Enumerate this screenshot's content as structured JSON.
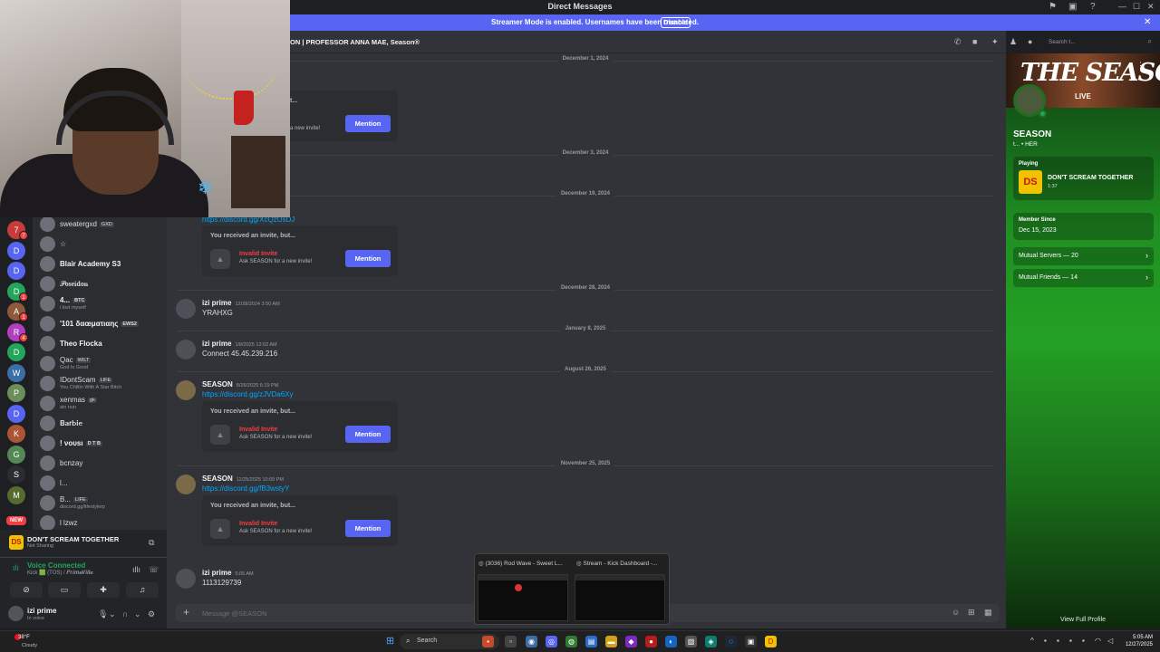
{
  "window": {
    "title": "Direct Messages"
  },
  "banner": {
    "text": "Streamer Mode is enabled. Usernames have been truncated.",
    "button": "Disable"
  },
  "chat_header": {
    "title": "ON | PROFESSOR ANNA MAE, Season®"
  },
  "search": {
    "placeholder": "Search t..."
  },
  "dm_list": [
    {
      "name": "sweatergxd",
      "tag": "GXD",
      "sub": "",
      "bold": false
    },
    {
      "name": "☆",
      "tag": "",
      "sub": "",
      "bold": false
    },
    {
      "name": "Blair Academy S3",
      "tag": "",
      "sub": "",
      "bold": true
    },
    {
      "name": "𝓟𝐨𝐬𝐞𝐢𝐝𝐨𝐧",
      "tag": "",
      "sub": "",
      "bold": false
    },
    {
      "name": "4...",
      "tag": "BTC",
      "sub": "i lost myself",
      "bold": true
    },
    {
      "name": "'101 δαœματιαης",
      "tag": "EWS2",
      "sub": "",
      "bold": true
    },
    {
      "name": "Theo Flocka",
      "tag": "",
      "sub": "",
      "bold": true
    },
    {
      "name": "Qac",
      "tag": "WILT",
      "sub": "God Is Good",
      "bold": false
    },
    {
      "name": "IDontScam",
      "tag": "LIFE",
      "sub": "You Chillin With A Star Bitch",
      "bold": false
    },
    {
      "name": "xenmas",
      "tag": "gk",
      "sub": "ain nun",
      "bold": false
    },
    {
      "name": "𝐁𝐚𝐫𝐛𝐢𝐞",
      "tag": "",
      "sub": "",
      "bold": false
    },
    {
      "name": "! νουѕι",
      "tag": "D T B",
      "sub": "",
      "bold": true
    },
    {
      "name": "bcnzay",
      "tag": "",
      "sub": "",
      "bold": false
    },
    {
      "name": "l...",
      "tag": "",
      "sub": "",
      "bold": false
    },
    {
      "name": "B...",
      "tag": "LIFE",
      "sub": "discord.gg/lifestylerp",
      "bold": false
    },
    {
      "name": "l lzwz",
      "tag": "",
      "sub": "",
      "bold": false
    }
  ],
  "servers": [
    {
      "label": "7",
      "color": "#c93b3b",
      "badge": "7"
    },
    {
      "label": "D",
      "color": "#5865f2",
      "badge": ""
    },
    {
      "label": "D",
      "color": "#5865f2",
      "badge": ""
    },
    {
      "label": "D",
      "color": "#23a55a",
      "badge": "1"
    },
    {
      "label": "A",
      "color": "#8e5a3a",
      "badge": "1"
    },
    {
      "label": "R",
      "color": "#b040c0",
      "badge": "4"
    },
    {
      "label": "D",
      "color": "#23a55a",
      "badge": ""
    },
    {
      "label": "W",
      "color": "#3a6ea5",
      "badge": ""
    },
    {
      "label": "P",
      "color": "#6b8e5a",
      "badge": ""
    },
    {
      "label": "D",
      "color": "#5865f2",
      "badge": ""
    },
    {
      "label": "K",
      "color": "#aa5533",
      "badge": ""
    },
    {
      "label": "G",
      "color": "#558855",
      "badge": ""
    },
    {
      "label": "S",
      "color": "#2b2d31",
      "badge": ""
    },
    {
      "label": "M",
      "color": "#556b2f",
      "badge": ""
    }
  ],
  "servers_new": "NEW",
  "activity": {
    "icon_text": "DS",
    "game": "DON'T SCREAM TOGETHER",
    "status": "Not Sharing"
  },
  "voice": {
    "title": "Voice Connected",
    "server": "Kick 🟩 (TOS) / 𝑷𝒓𝒊𝒎𝒂𝑽𝒊𝒍𝒍𝒆"
  },
  "user": {
    "name": "izi prime",
    "status": "In voice"
  },
  "dates": [
    {
      "text": "December 1, 2024"
    },
    {
      "text": "December 3, 2024"
    },
    {
      "text": "December 19, 2024"
    },
    {
      "text": "December 28, 2024"
    },
    {
      "text": "January 8, 2025"
    },
    {
      "text": "August 26, 2025"
    },
    {
      "text": "November 25, 2025"
    }
  ],
  "messages": [
    {
      "author": "",
      "time": "",
      "text": "",
      "link": "https://discord.gg/XcQzUsDJ"
    },
    {
      "author": "izi prime",
      "time": "12/28/2024 3:50 AM",
      "text": "YRAHXG",
      "link": ""
    },
    {
      "author": "izi prime",
      "time": "1/8/2025 12:02 AM",
      "text": "Connect 45.45.239.216",
      "link": ""
    },
    {
      "author": "SEASON",
      "time": "8/26/2025 6:19 PM",
      "text": "",
      "link": "https://discord.gg/zJVDa6Xy"
    },
    {
      "author": "SEASON",
      "time": "11/25/2025 10:09 PM",
      "text": "",
      "link": "https://discord.gg/fB3wstyY"
    },
    {
      "author": "izi prime",
      "time": "5:05 AM",
      "text": "1113129739",
      "link": ""
    }
  ],
  "invite": {
    "header": "You received an invite, but...",
    "title": "Invalid Invite",
    "sub": "Ask SEASON for a new invite!",
    "button": "Mention"
  },
  "invite_top_partial": {
    "header": "t...",
    "sub": "a new invite!"
  },
  "composer": {
    "placeholder": "Message @SEASON"
  },
  "profile": {
    "banner_text": "THE SEASON",
    "live": "LIVE",
    "name": "SEASON",
    "pronouns": "t... • HER",
    "playing_label": "Playing",
    "game_icon": "DS",
    "game": "DON'T SCREAM TOGETHER",
    "game_time": "1:37",
    "member_since_label": "Member Since",
    "member_since": "Dec 15, 2023",
    "mutual_servers": "Mutual Servers — 20",
    "mutual_friends": "Mutual Friends — 14",
    "view_full": "View Full Profile"
  },
  "preview": {
    "tab1": "(3036) Rod Wave - Sweet L...",
    "tab2": "Stream - Kick Dashboard -..."
  },
  "taskbar": {
    "weather_temp": "38°F",
    "weather_desc": "Cloudy",
    "search": "Search",
    "time": "5:05 AM",
    "date": "12/27/2025"
  }
}
